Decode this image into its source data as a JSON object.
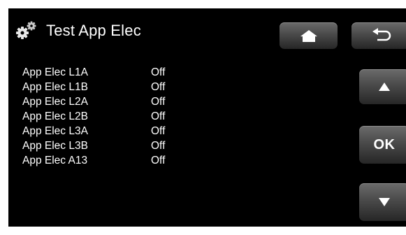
{
  "header": {
    "title": "Test App Elec",
    "icon": "gears-icon"
  },
  "toolbar": {
    "home_icon": "home-icon",
    "back_icon": "back-arrow-icon",
    "up_icon": "up-arrow-icon",
    "ok_label": "OK",
    "down_icon": "down-arrow-icon"
  },
  "items": [
    {
      "name": "App Elec L1A",
      "value": "Off"
    },
    {
      "name": "App Elec L1B",
      "value": "Off"
    },
    {
      "name": "App Elec L2A",
      "value": "Off"
    },
    {
      "name": "App Elec L2B",
      "value": "Off"
    },
    {
      "name": "App Elec L3A",
      "value": "Off"
    },
    {
      "name": "App Elec L3B",
      "value": "Off"
    },
    {
      "name": "App Elec A13",
      "value": "Off"
    }
  ],
  "colors": {
    "background": "#000000",
    "text": "#ffffff",
    "button": "#4a4a4a"
  }
}
